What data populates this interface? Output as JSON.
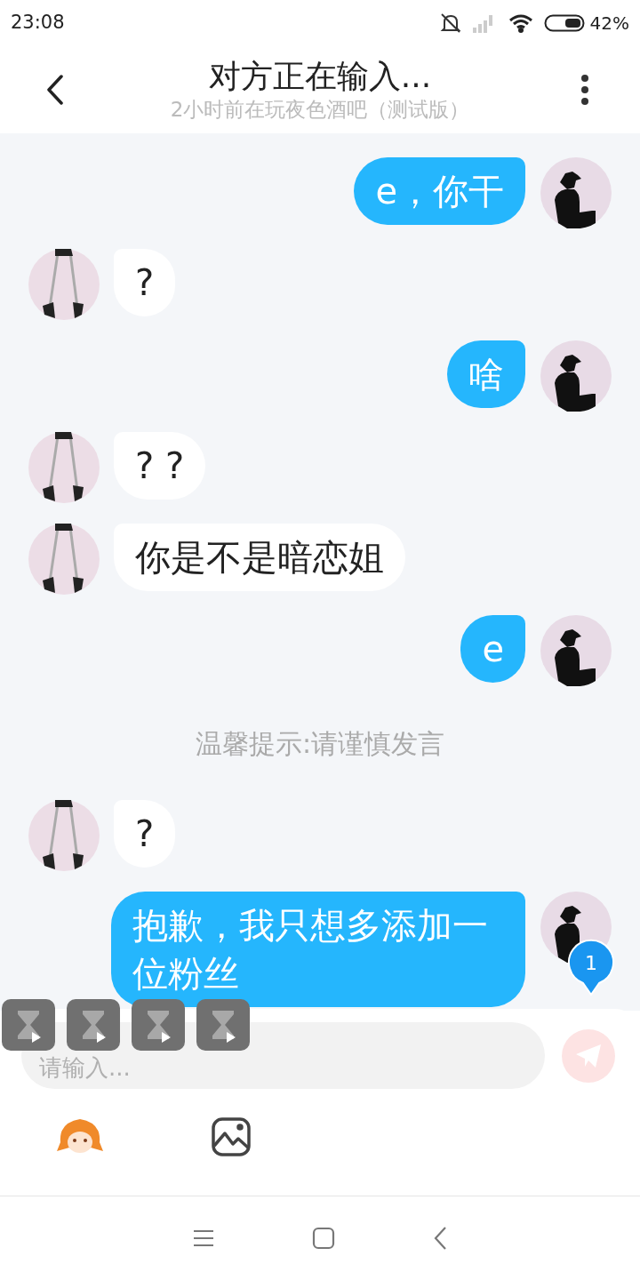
{
  "status_bar": {
    "time": "23:08",
    "battery": "42%"
  },
  "header": {
    "title": "对方正在输入...",
    "subtitle": "2小时前在玩夜色酒吧（测试版）"
  },
  "messages": [
    {
      "kind": "sent",
      "text": "e，你干"
    },
    {
      "kind": "received",
      "text": "?"
    },
    {
      "kind": "sent",
      "text": "啥"
    },
    {
      "kind": "received",
      "text": "? ?"
    },
    {
      "kind": "received",
      "text": "你是不是暗恋姐"
    },
    {
      "kind": "sent",
      "text": "e"
    },
    {
      "kind": "notice",
      "text": "温馨提示:请谨慎发言"
    },
    {
      "kind": "received",
      "text": "?"
    },
    {
      "kind": "sent",
      "text": "抱歉，我只想多添加一位粉丝"
    }
  ],
  "unread_badge": "1",
  "floating_buttons": [
    {
      "kind": "hourglass"
    },
    {
      "kind": "hourglass"
    },
    {
      "kind": "hourglass"
    },
    {
      "kind": "hourglass"
    }
  ],
  "composer": {
    "placeholder": "请输入..."
  }
}
